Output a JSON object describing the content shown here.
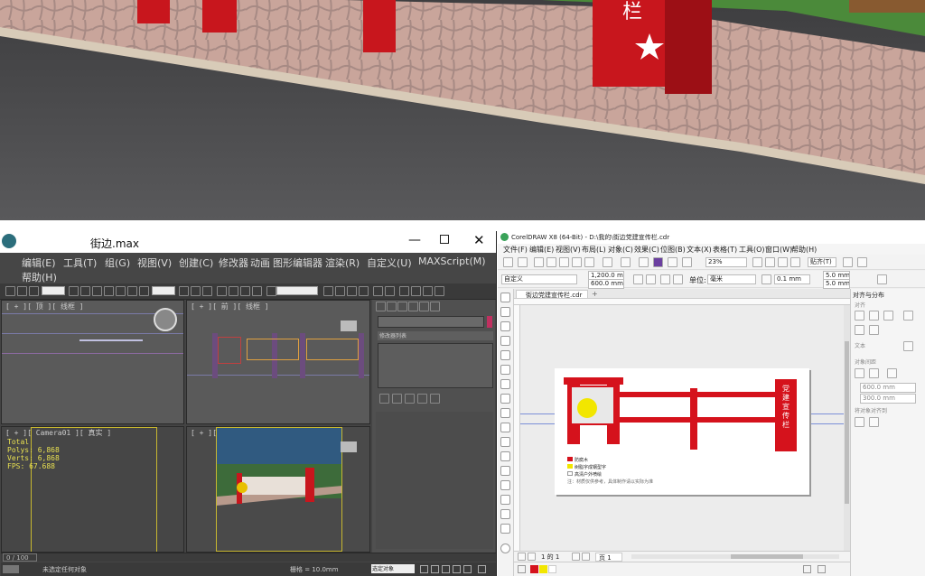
{
  "max": {
    "window_title": "街边.max",
    "menus": [
      "编辑(E)",
      "工具(T)",
      "组(G)",
      "视图(V)",
      "创建(C)",
      "修改器",
      "动画",
      "图形编辑器",
      "渲染(R)",
      "自定义(U)",
      "MAXScript(M)",
      "帮助(H)"
    ],
    "viewports": {
      "top_left_label": "[ + ][ 顶 ][ 线框 ]",
      "top_right_label": "[ + ][ 前 ][ 线框 ]",
      "bottom_left_label": "[ + ][ Camera01 ][ 真实 ]",
      "bottom_right_label": "[ + ][ 透视 ][ 真实 ]",
      "stats": [
        "Total",
        "Polys: 6,868",
        "Verts: 6,868",
        "FPS: 67.688"
      ]
    },
    "command_panel": {
      "list_label": "修改器列表"
    },
    "timeline": {
      "frame": "0 / 100"
    },
    "status": {
      "selection": "未选定任何对象",
      "hint": "栅格 = 10.0mm",
      "key_mode": "选定对象"
    }
  },
  "corel": {
    "window_title": "CorelDRAW X8 (64-Bit) - D:\\我的\\街边党建宣传栏.cdr",
    "menus": [
      "文件(F)",
      "编辑(E)",
      "视图(V)",
      "布局(L)",
      "对象(C)",
      "效果(C)",
      "位图(B)",
      "文本(X)",
      "表格(T)",
      "工具(O)",
      "窗口(W)",
      "帮助(H)"
    ],
    "zoom": "23%",
    "snap": "贴齐(T)",
    "page_preset": "自定义",
    "width": "1,200.0 mm",
    "height": "600.0 mm",
    "units_label": "单位:",
    "units": "毫米",
    "nudge": "0.1 mm",
    "dup_x": "5.0 mm",
    "dup_y": "5.0 mm",
    "doc_tab": "街边党建宣传栏.cdr",
    "artwork": {
      "vertical_banner": "党建宣传栏",
      "legend": [
        "防腐木",
        "树脂字成钢型字",
        "高清户外喷绘"
      ],
      "note": "注：材质仅供参考，具体制作请以实际为准"
    },
    "docker": {
      "title": "对齐与分布",
      "section_align": "对齐",
      "section_text": "文本",
      "section_distribute": "对象间距",
      "x_value": "600.0 mm",
      "y_value": "300.0 mm",
      "section_origin": "将对象对齐到"
    },
    "page_nav": {
      "page": "1 的 1",
      "page_tab": "页 1"
    },
    "colors": {
      "red": "#d5121c",
      "yellow": "#f2e600",
      "white": "#ffffff"
    }
  }
}
